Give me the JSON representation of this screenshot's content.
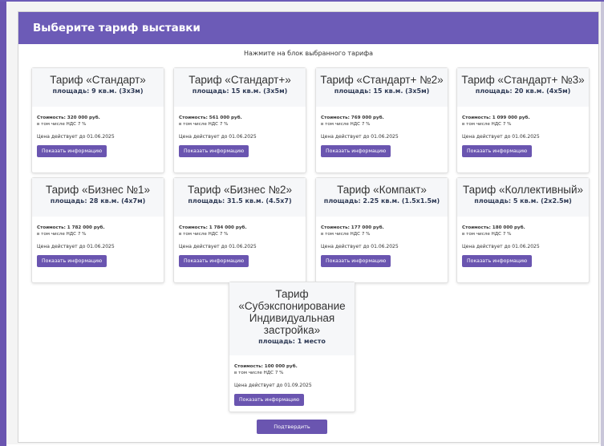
{
  "header": {
    "title": "Выберите тариф выставки"
  },
  "hint": "Нажмите на блок выбранного тарифа",
  "cards": [
    {
      "title": "Тариф «Стандарт»",
      "area": "площадь: 9 кв.м. (3х3м)",
      "price": "Стоимость: 320 000 руб.",
      "vat": "в том числе НДС 7 %",
      "valid": "Цена действует до 01.06.2025",
      "button": "Показать информацию"
    },
    {
      "title": "Тариф «Стандарт+»",
      "area": "площадь: 15 кв.м. (3х5м)",
      "price": "Стоимость: 561 000 руб.",
      "vat": "в том числе НДС 7 %",
      "valid": "Цена действует до 01.06.2025",
      "button": "Показать информацию"
    },
    {
      "title": "Тариф «Стандарт+ №2»",
      "area": "площадь: 15 кв.м. (3х5м)",
      "price": "Стоимость: 769 000 руб.",
      "vat": "в том числе НДС 7 %",
      "valid": "Цена действует до 01.06.2025",
      "button": "Показать информацию"
    },
    {
      "title": "Тариф «Стандарт+ №3»",
      "area": "площадь: 20 кв.м. (4х5м)",
      "price": "Стоимость: 1 099 000 руб.",
      "vat": "в том числе НДС 7 %",
      "valid": "Цена действует до 01.06.2025",
      "button": "Показать информацию"
    },
    {
      "title": "Тариф «Бизнес №1»",
      "area": "площадь: 28 кв.м. (4х7м)",
      "price": "Стоимость: 1 782 000 руб.",
      "vat": "в том числе НДС 7 %",
      "valid": "Цена действует до 01.06.2025",
      "button": "Показать информацию"
    },
    {
      "title": "Тариф «Бизнес №2»",
      "area": "площадь: 31.5 кв.м. (4.5х7)",
      "price": "Стоимость: 1 784 000 руб.",
      "vat": "в том числе НДС 7 %",
      "valid": "Цена действует до 01.06.2025",
      "button": "Показать информацию"
    },
    {
      "title": "Тариф «Компакт»",
      "area": "площадь: 2.25 кв.м. (1.5х1.5м)",
      "price": "Стоимость: 177 000 руб.",
      "vat": "в том числе НДС 7 %",
      "valid": "Цена действует до 01.06.2025",
      "button": "Показать информацию"
    },
    {
      "title": "Тариф «Коллективный»",
      "area": "площадь: 5 кв.м. (2х2.5м)",
      "price": "Стоимость: 180 000 руб.",
      "vat": "в том числе НДС 7 %",
      "valid": "Цена действует до 01.06.2025",
      "button": "Показать информацию"
    },
    {
      "title": "Тариф «Субэкспонирование Индивидуальная застройка»",
      "area": "площадь: 1 место",
      "price": "Стоимость: 100 000 руб.",
      "vat": "в том числе НДС 7 %",
      "valid": "Цена действует до 01.09.2025",
      "button": "Показать информацию"
    }
  ],
  "confirm": "Подтвердить"
}
